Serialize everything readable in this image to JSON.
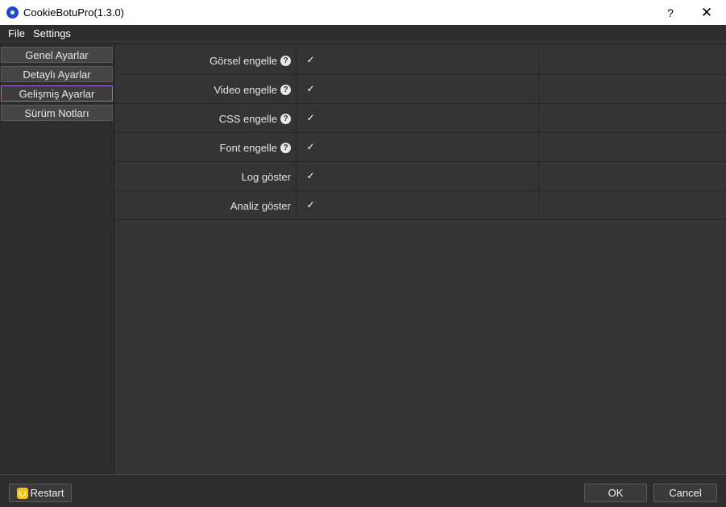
{
  "window": {
    "title": "CookieBotuPro(1.3.0)",
    "help_glyph": "?",
    "close_glyph": "✕"
  },
  "menu": [
    "File",
    "Settings"
  ],
  "sidebar": {
    "items": [
      {
        "label": "Genel Ayarlar",
        "active": false
      },
      {
        "label": "Detaylı Ayarlar",
        "active": false
      },
      {
        "label": "Gelişmiş Ayarlar",
        "active": true
      },
      {
        "label": "Sürüm Notları",
        "active": false
      }
    ]
  },
  "settings": {
    "rows": [
      {
        "label": "Görsel engelle",
        "help": true,
        "checked": true
      },
      {
        "label": "Video engelle",
        "help": true,
        "checked": true
      },
      {
        "label": "CSS engelle",
        "help": true,
        "checked": true
      },
      {
        "label": "Font engelle",
        "help": true,
        "checked": true
      },
      {
        "label": "Log göster",
        "help": false,
        "checked": true
      },
      {
        "label": "Analiz göster",
        "help": false,
        "checked": true
      }
    ],
    "help_glyph": "?",
    "check_glyph": "✓"
  },
  "footer": {
    "restart_label": "Restart",
    "ok_label": "OK",
    "cancel_label": "Cancel"
  },
  "colors": {
    "active_border": "#9a6fd0",
    "background": "#2d2d2d",
    "panel": "#343434",
    "app_icon": "#1f48c9",
    "restart_icon": "#f0c419"
  }
}
